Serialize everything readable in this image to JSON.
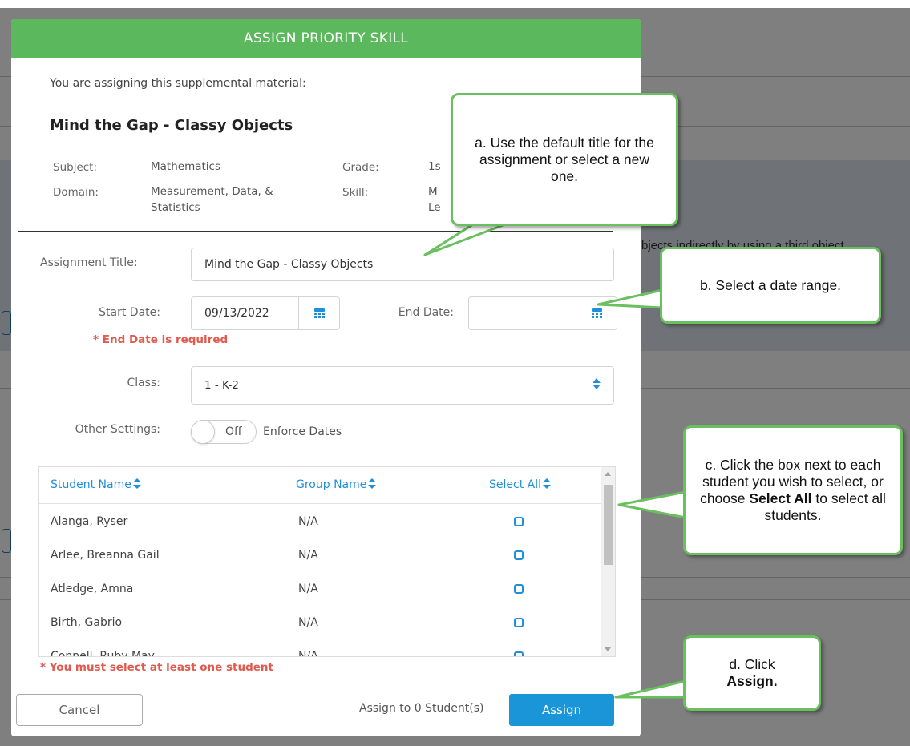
{
  "background": {
    "partial_text": "bjects indirectly by using a third object."
  },
  "modal": {
    "title": "ASSIGN PRIORITY SKILL",
    "intro": "You are assigning this supplemental material:",
    "material_title": "Mind the Gap - Classy Objects",
    "meta": {
      "subject_label": "Subject:",
      "subject_value": "Mathematics",
      "grade_label": "Grade:",
      "grade_value": "1s",
      "domain_label": "Domain:",
      "domain_value_line1": "Measurement, Data, &",
      "domain_value_line2": "Statistics",
      "skill_label": "Skill:",
      "skill_value_line1": "M",
      "skill_value_line2": "Le"
    },
    "form": {
      "assignment_title_label": "Assignment Title:",
      "assignment_title_value": "Mind the Gap - Classy Objects",
      "start_date_label": "Start Date:",
      "start_date_value": "09/13/2022",
      "end_date_label": "End Date:",
      "end_date_value": "",
      "end_date_error": "* End Date is required",
      "class_label": "Class:",
      "class_value": "1 - K-2",
      "other_settings_label": "Other Settings:",
      "toggle_state": "Off",
      "toggle_label": "Enforce Dates"
    },
    "table": {
      "headers": [
        "Student Name",
        "Group Name",
        "Select All"
      ],
      "rows": [
        {
          "name": "Alanga, Ryser",
          "group": "N/A",
          "selected": false
        },
        {
          "name": "Arlee, Breanna Gail",
          "group": "N/A",
          "selected": false
        },
        {
          "name": "Atledge, Amna",
          "group": "N/A",
          "selected": false
        },
        {
          "name": "Birth, Gabrio",
          "group": "N/A",
          "selected": false
        },
        {
          "name": "Connell, Ruby May",
          "group": "N/A",
          "selected": false
        }
      ],
      "error": "* You must select at least one student"
    },
    "footer": {
      "cancel_label": "Cancel",
      "assign_count": "Assign to 0 Student(s)",
      "assign_label": "Assign"
    }
  },
  "callouts": {
    "a": "a. Use the default title for the assignment or select a new one.",
    "b": "b. Select a date range.",
    "c_prefix": "c. Click the box next to each student you wish to select, or choose ",
    "c_bold": "Select All",
    "c_suffix": " to select all students.",
    "d_prefix": "d. Click",
    "d_bold": "Assign."
  },
  "colors": {
    "header_green": "#5cb85c",
    "accent_blue": "#1e8fd8",
    "error_red": "#e05a4e",
    "callout_border": "#6abf5e"
  }
}
